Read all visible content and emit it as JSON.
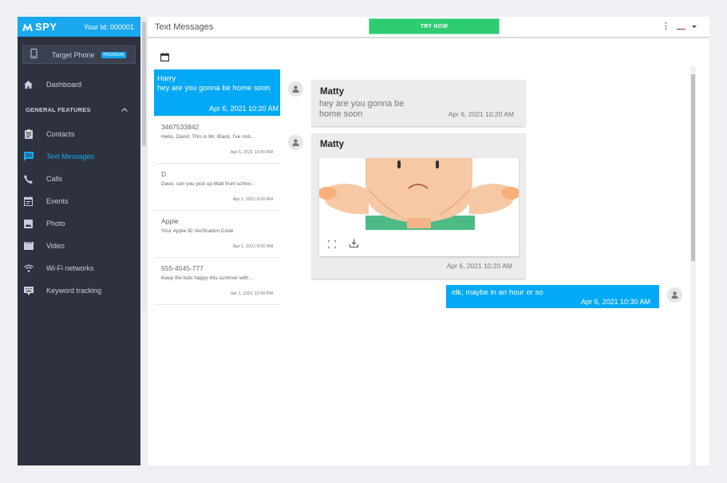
{
  "sidebar": {
    "brand": "SPY",
    "user_id": "Your Id: 000001",
    "target_phone": {
      "label": "Target Phone",
      "badge": "PREMIUM"
    },
    "dashboard": "Dashboard",
    "section": "GENERAL FEATURES",
    "items": [
      {
        "label": "Contacts",
        "icon": "contacts-icon"
      },
      {
        "label": "Text Messages",
        "icon": "message-icon",
        "active": true
      },
      {
        "label": "Calls",
        "icon": "phone-icon"
      },
      {
        "label": "Events",
        "icon": "calendar-icon"
      },
      {
        "label": "Photo",
        "icon": "image-icon"
      },
      {
        "label": "Video",
        "icon": "video-icon"
      },
      {
        "label": "Wi-Fi networks",
        "icon": "wifi-icon"
      },
      {
        "label": "Keyword tracking",
        "icon": "keyboard-icon"
      }
    ]
  },
  "header": {
    "title": "Text Messages",
    "cta": "TRY NOW"
  },
  "conversations": [
    {
      "name": "Harry",
      "preview": "hey are you gonna be home soon",
      "time": "Apr 6, 2021 10:20 AM",
      "selected": true
    },
    {
      "name": "3467533842",
      "preview": "Hello, David. This is Mr. Black. I've noti...",
      "time": "Apr 5, 2021 10:00 AM"
    },
    {
      "name": "D",
      "preview": "Dave, can you pick up Matt from schoo...",
      "time": "Apr 1, 2021 8:00 AM"
    },
    {
      "name": "Apple",
      "preview": "Your Apple ID Verification Code",
      "time": "Apr 1, 2021 8:00 AM"
    },
    {
      "name": "555-4545-777",
      "preview": "Keep the kids happy this summer with ...",
      "time": "Jan 1, 2021 12:00 PM"
    }
  ],
  "messages": [
    {
      "sender": "Matty",
      "text_line1": "hey are you gonna be",
      "text_line2": "home soon",
      "time": "Apr 6, 2021 10:20 AM"
    },
    {
      "sender": "Matty",
      "attachment": "image",
      "time": "Apr 6, 2021 10:20 AM"
    },
    {
      "outgoing": true,
      "text": "idk, maybe in an hour or so",
      "time": "Apr 6, 2021 10:30 AM"
    }
  ],
  "colors": {
    "accent": "#03a9f4",
    "sidebar_bg": "#2d323e",
    "cta": "#2ecc71"
  }
}
